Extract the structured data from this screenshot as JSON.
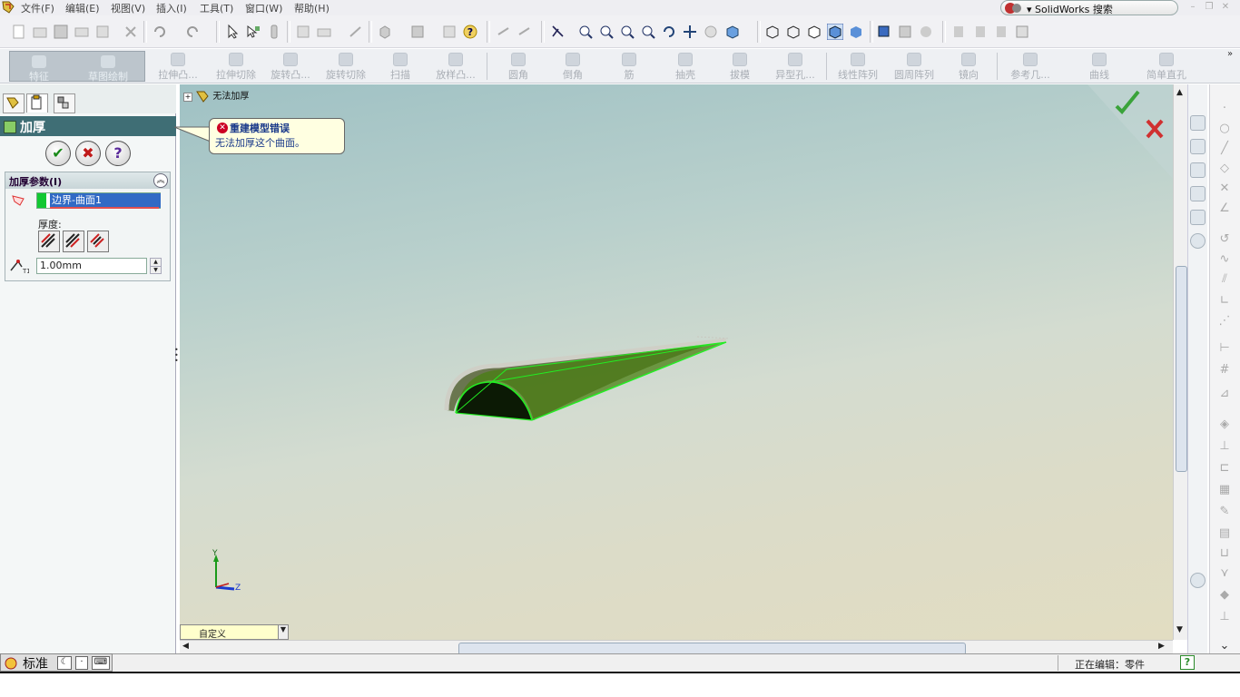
{
  "menubar": {
    "items": [
      "文件(F)",
      "编辑(E)",
      "视图(V)",
      "插入(I)",
      "工具(T)",
      "窗口(W)",
      "帮助(H)"
    ],
    "search_label": "▾ SolidWorks 搜索"
  },
  "command_manager": {
    "tabs": [
      "特征",
      "草图绘制"
    ],
    "buttons": [
      "拉伸凸...",
      "拉伸切除",
      "旋转凸...",
      "旋转切除",
      "扫描",
      "放样凸...",
      "圆角",
      "倒角",
      "筋",
      "抽壳",
      "拔模",
      "异型孔...",
      "线性阵列",
      "圆周阵列",
      "镜向",
      "参考几...",
      "曲线",
      "简单直孔"
    ]
  },
  "property_manager": {
    "title": "加厚",
    "group_title": "加厚参数(I)",
    "selected_face": "边界-曲面1",
    "thickness_label": "厚度:",
    "thickness_value": "1.00mm"
  },
  "error_tooltip": {
    "title": "重建模型错误",
    "message": "无法加厚这个曲面。"
  },
  "viewport": {
    "tree_root": "无法加厚",
    "view_combo": "自定义",
    "triad_y": "Y",
    "triad_z": "Z"
  },
  "statusbar": {
    "left_label": "标准",
    "editing": "正在编辑：零件",
    "help": "?"
  },
  "colors": {
    "pm_title_bg": "#3f6e75",
    "selection": "#316ac5",
    "feature_green": "#12c832"
  }
}
